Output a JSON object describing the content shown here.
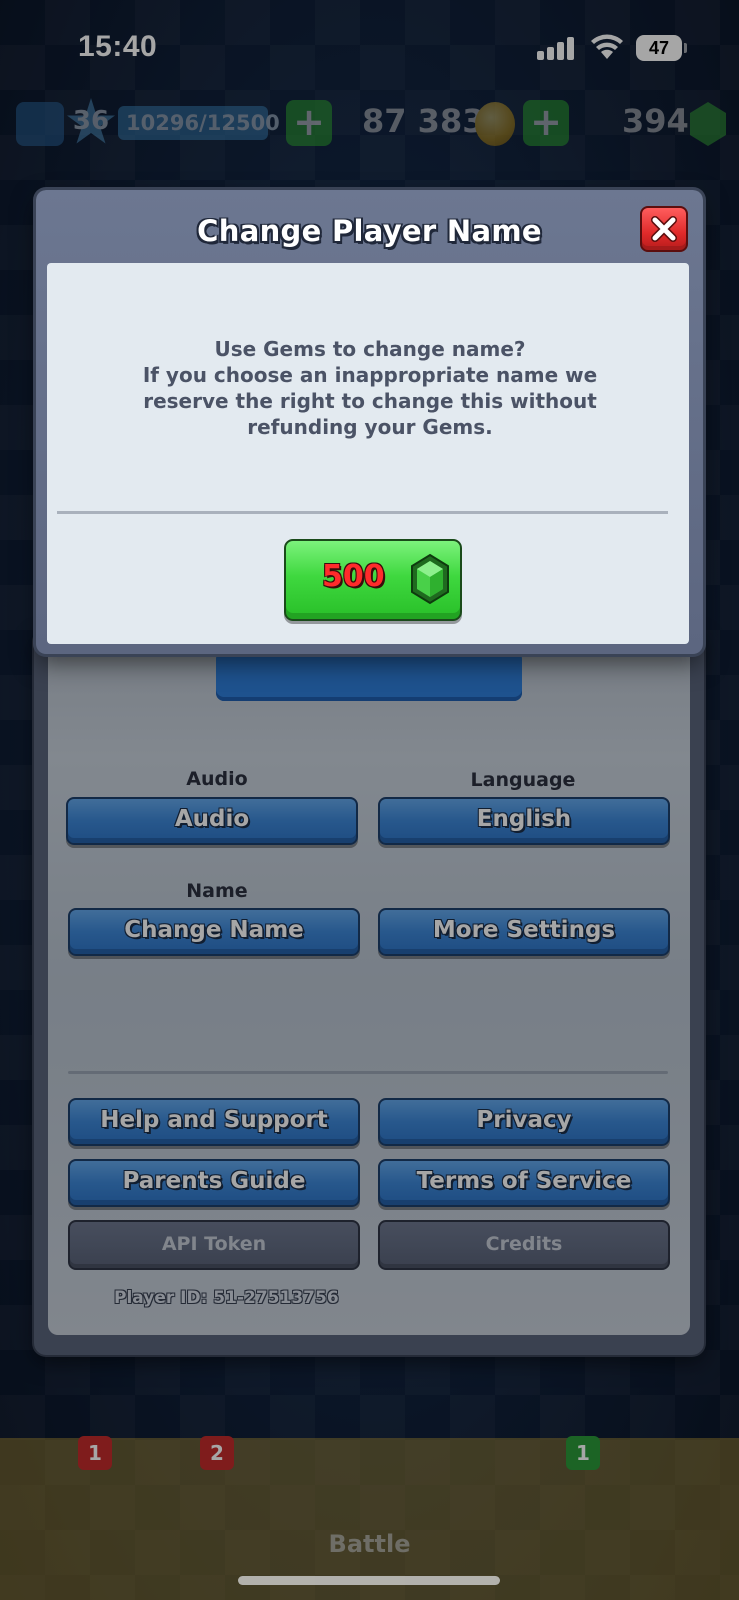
{
  "status_bar": {
    "time": "15:40",
    "battery": "47"
  },
  "resources": {
    "level": "36",
    "xp": "10296/12500",
    "gold": "87 383",
    "gems": "394"
  },
  "modal": {
    "title": "Change Player Name",
    "message_lines": [
      "Use Gems to change name?",
      "If you choose an inappropriate name we",
      "reserve the right to change this without",
      "refunding your Gems."
    ],
    "price": "500"
  },
  "settings": {
    "audio_label": "Audio",
    "audio_button": "Audio",
    "language_label": "Language",
    "language_button": "English",
    "name_label": "Name",
    "change_name_button": "Change Name",
    "more_settings_button": "More Settings",
    "help_button": "Help and Support",
    "privacy_button": "Privacy",
    "parents_guide_button": "Parents Guide",
    "terms_button": "Terms of Service",
    "api_token_button": "API Token",
    "credits_button": "Credits",
    "player_id": "Player ID: 51-27513756"
  },
  "bottom_nav": {
    "battle_label": "Battle",
    "chest_badge": "1",
    "cards_badge": "2",
    "clan_badge": "1"
  },
  "colors": {
    "accent_blue": "#3d87d8",
    "close_red": "#e02a2a",
    "price_green": "#3fd83f",
    "price_text_red": "#ff2b2b"
  }
}
